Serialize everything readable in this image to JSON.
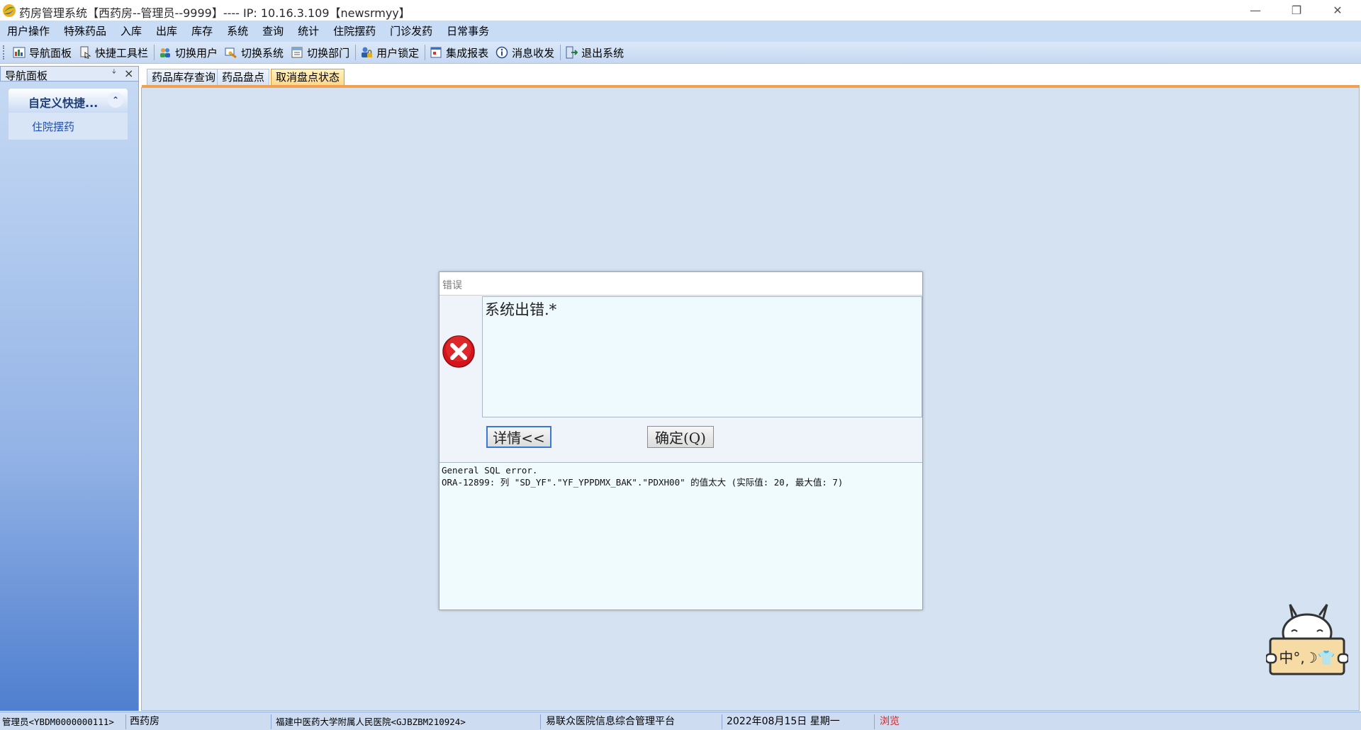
{
  "window": {
    "title": "药房管理系统【西药房--管理员--9999】---- IP:  10.16.3.109【newsrmyy】",
    "minimize_glyph": "—",
    "maximize_glyph": "❐",
    "close_glyph": "✕"
  },
  "menu": [
    "用户操作",
    "特殊药品",
    "入库",
    "出库",
    "库存",
    "系统",
    "查询",
    "统计",
    "住院摆药",
    "门诊发药",
    "日常事务"
  ],
  "toolbar": [
    {
      "label": "导航面板",
      "icon": "navigation-panel-icon"
    },
    {
      "label": "快捷工具栏",
      "icon": "shortcut-toolbar-icon"
    },
    {
      "label": "切换用户",
      "icon": "switch-user-icon"
    },
    {
      "label": "切换系统",
      "icon": "switch-system-icon"
    },
    {
      "label": "切换部门",
      "icon": "switch-department-icon"
    },
    {
      "label": "用户锁定",
      "icon": "user-lock-icon"
    },
    {
      "label": "集成报表",
      "icon": "integrated-report-icon"
    },
    {
      "label": "消息收发",
      "icon": "message-icon"
    },
    {
      "label": "退出系统",
      "icon": "exit-icon"
    }
  ],
  "nav_panel": {
    "title": "导航面板",
    "pin_glyph": "ᛎ",
    "close_glyph": "×",
    "group_title": "自定义快捷...",
    "collapse_glyph": "⌃",
    "items": [
      "住院摆药"
    ]
  },
  "tabs": [
    {
      "label": "药品库存查询",
      "active": false
    },
    {
      "label": "药品盘点",
      "active": false
    },
    {
      "label": "取消盘点状态",
      "active": true
    }
  ],
  "dialog": {
    "title": "错误",
    "message": "系统出错.*",
    "details_button": "详情<<",
    "ok_button": "确定(Q)",
    "details": [
      "General SQL error.",
      "ORA-12899: 列 \"SD_YF\".\"YF_YPPDMX_BAK\".\"PDXH00\" 的值太大 (实际值: 20, 最大值: 7)"
    ]
  },
  "ime": {
    "label": "中°,☽👕"
  },
  "status_bar": [
    "管理员<YBDM0000000111>",
    "西药房",
    "福建中医药大学附属人民医院<GJBZBM210924>",
    "易联众医院信息综合管理平台",
    "2022年08月15日  星期一",
    "浏览"
  ],
  "colors": {
    "status_browse": "#e02020",
    "tab_active": "#ffd88a",
    "accent_underline": "#f0a050",
    "error_red": "#d4141c"
  }
}
